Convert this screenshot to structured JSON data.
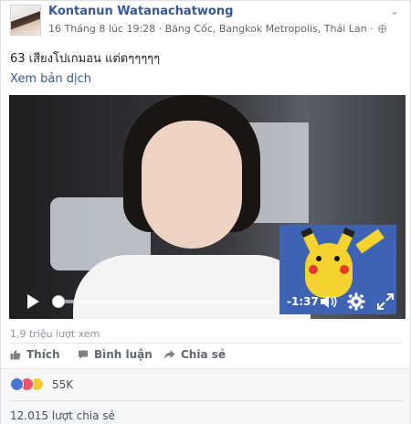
{
  "post": {
    "author": "Kontanun Watanachatwong",
    "meta": "16 Tháng 8 lúc 19:28 · Băng Cốc, Bangkok Metropolis, Thái Lan ·",
    "privacy_icon": "globe-icon",
    "text": "63 เสียงโปเกมอน แต่ดๆๆๆๆๆ",
    "translate_link": "Xem bản dịch"
  },
  "video": {
    "time_remaining": "-1:37",
    "progress": 0.0,
    "icons": [
      "play-icon",
      "volume-icon",
      "gear-icon",
      "expand-icon"
    ]
  },
  "stats": {
    "views": "1,9 triệu lượt xem"
  },
  "actions": {
    "like": "Thích",
    "comment": "Bình luận",
    "share": "Chia sẻ"
  },
  "footer": {
    "reaction_count": "55K",
    "shares": "12.015 lượt chia sẻ"
  },
  "colors": {
    "link_blue": "#365899",
    "like_blue": "#4a76d8",
    "love_red": "#f25268",
    "haha_yellow": "#f7c738"
  }
}
